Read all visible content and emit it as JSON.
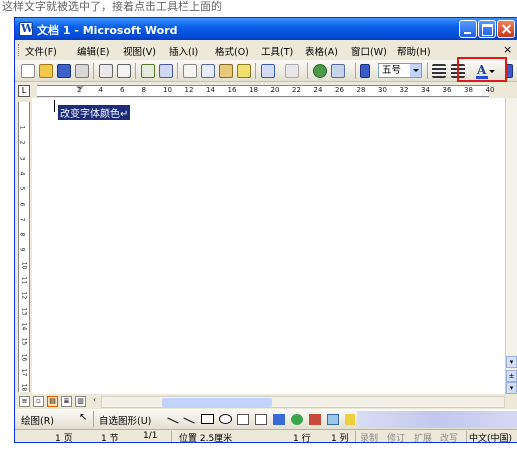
{
  "top_caption": "这样文字就被选中了，接着点击工具栏上面的",
  "window": {
    "title": "文档 1 - Microsoft Word"
  },
  "menu": {
    "items": [
      "文件(F)",
      "编辑(E)",
      "视图(V)",
      "插入(I)",
      "格式(O)",
      "工具(T)",
      "表格(A)",
      "窗口(W)",
      "帮助(H)"
    ],
    "close_symbol": "×"
  },
  "toolbar": {
    "font_size": "五号",
    "font_color_glyph": "A",
    "font_color_value": "#1f4fd8"
  },
  "ruler": {
    "corner_glyph": "L",
    "numbers": [
      "2",
      "4",
      "6",
      "8",
      "10",
      "12",
      "14",
      "16",
      "18",
      "20",
      "22",
      "24",
      "26",
      "28",
      "30",
      "32",
      "34",
      "36",
      "38",
      "40"
    ]
  },
  "vruler": {
    "numbers": [
      "1",
      "2",
      "3",
      "4",
      "5",
      "6",
      "7",
      "8",
      "9",
      "10",
      "11",
      "12",
      "13",
      "14",
      "15",
      "16",
      "17",
      "18"
    ]
  },
  "document": {
    "selected_text": "改变字体颜色↵"
  },
  "drawing_toolbar": {
    "draw_label": "绘图(R)",
    "autoshapes_label": "自选图形(U)"
  },
  "statusbar": {
    "page": "1 页",
    "section": "1 节",
    "page_of": "1/1",
    "position": "位置 2.5厘米",
    "line": "1 行",
    "column": "1 列",
    "rec": "录制",
    "trk": "修订",
    "ext": "扩展",
    "ovr": "改写",
    "language": "中文(中国)"
  }
}
